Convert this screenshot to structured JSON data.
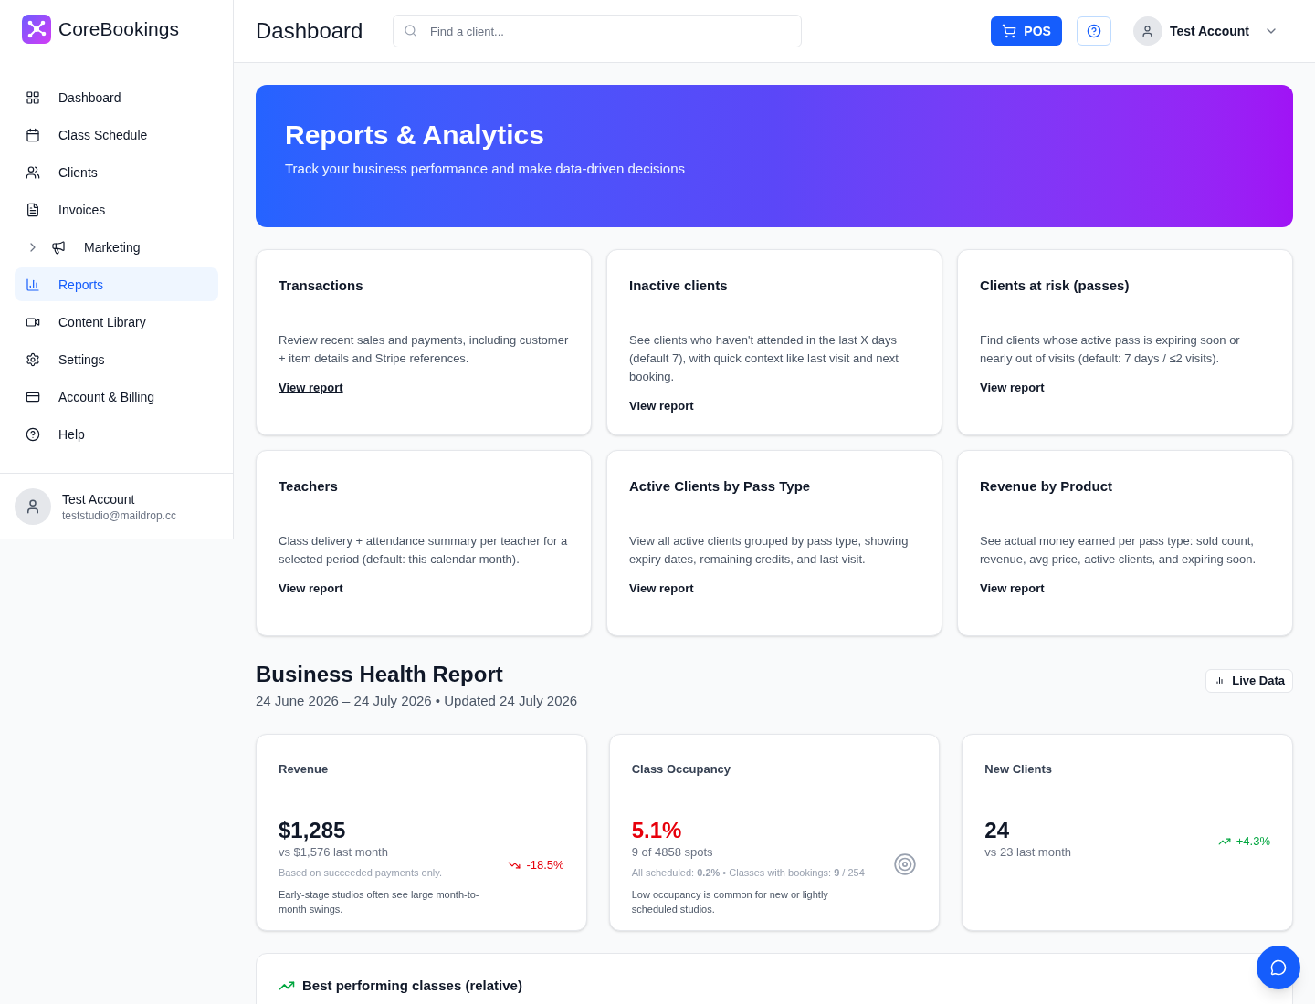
{
  "brand": {
    "name": "CoreBookings"
  },
  "sidebar": {
    "items": [
      {
        "label": "Dashboard",
        "kind": "link",
        "selected": false
      },
      {
        "label": "Class Schedule",
        "kind": "link",
        "selected": false
      },
      {
        "label": "Clients",
        "kind": "link",
        "selected": false
      },
      {
        "label": "Invoices",
        "kind": "link",
        "selected": false
      },
      {
        "label": "Marketing",
        "kind": "group",
        "selected": false
      },
      {
        "label": "Reports",
        "kind": "link",
        "selected": true
      },
      {
        "label": "Content Library",
        "kind": "link",
        "selected": false
      },
      {
        "label": "Settings",
        "kind": "link",
        "selected": false
      },
      {
        "label": "Account & Billing",
        "kind": "link",
        "selected": false
      },
      {
        "label": "Help",
        "kind": "link",
        "selected": false
      }
    ],
    "account": {
      "name": "Test Account",
      "email": "teststudio@maildrop.cc"
    }
  },
  "header": {
    "title": "Dashboard",
    "search": {
      "placeholder": "Find a client..."
    },
    "pos_button": "POS",
    "user": "Test Account"
  },
  "hero": {
    "title": "Reports & Analytics",
    "subtitle": "Track your business performance and make data-driven decisions"
  },
  "report_cards": [
    {
      "title": "Transactions",
      "description": "Review recent sales and payments, including customer + item details and Stripe references.",
      "link": "View report",
      "underlined": true
    },
    {
      "title": "Inactive clients",
      "description": "See clients who haven't attended in the last X days (default 7), with quick context like last visit and next booking.",
      "link": "View report",
      "underlined": false
    },
    {
      "title": "Clients at risk (passes)",
      "description": "Find clients whose active pass is expiring soon or nearly out of visits (default: 7 days / ≤2 visits).",
      "link": "View report",
      "underlined": false
    },
    {
      "title": "Teachers",
      "description": "Class delivery + attendance summary per teacher for a selected period (default: this calendar month).",
      "link": "View report",
      "underlined": false
    },
    {
      "title": "Active Clients by Pass Type",
      "description": "View all active clients grouped by pass type, showing expiry dates, remaining credits, and last visit.",
      "link": "View report",
      "underlined": false
    },
    {
      "title": "Revenue by Product",
      "description": "See actual money earned per pass type: sold count, revenue, avg price, active clients, and expiring soon.",
      "link": "View report",
      "underlined": false
    }
  ],
  "health": {
    "title": "Business Health Report",
    "period": "24 June 2026 – 24 July 2026 • Updated 24 July 2026",
    "badge": "Live Data",
    "metrics": [
      {
        "kind": "trend",
        "title": "Revenue",
        "value": "$1,285",
        "alert": false,
        "subtitle": "vs $1,576 last month",
        "detail": "Based on succeeded payments only.",
        "note": "Early-stage studios often see large month-to-month swings.",
        "trend": {
          "rising": false,
          "text": "-18.5%"
        }
      },
      {
        "kind": "target",
        "title": "Class Occupancy",
        "value": "5.1%",
        "alert": true,
        "subtitle": "9 of 4858 spots",
        "detail": "All scheduled: **0.2%** • Classes with bookings: **9** / 254",
        "note": "Low occupancy is common for new or lightly scheduled studios."
      },
      {
        "kind": "trend",
        "title": "New Clients",
        "value": "24",
        "alert": false,
        "subtitle": "vs 23 last month",
        "trend": {
          "rising": true,
          "text": "+4.3%"
        }
      }
    ]
  },
  "best_classes": {
    "title": "Best performing classes (relative)"
  }
}
